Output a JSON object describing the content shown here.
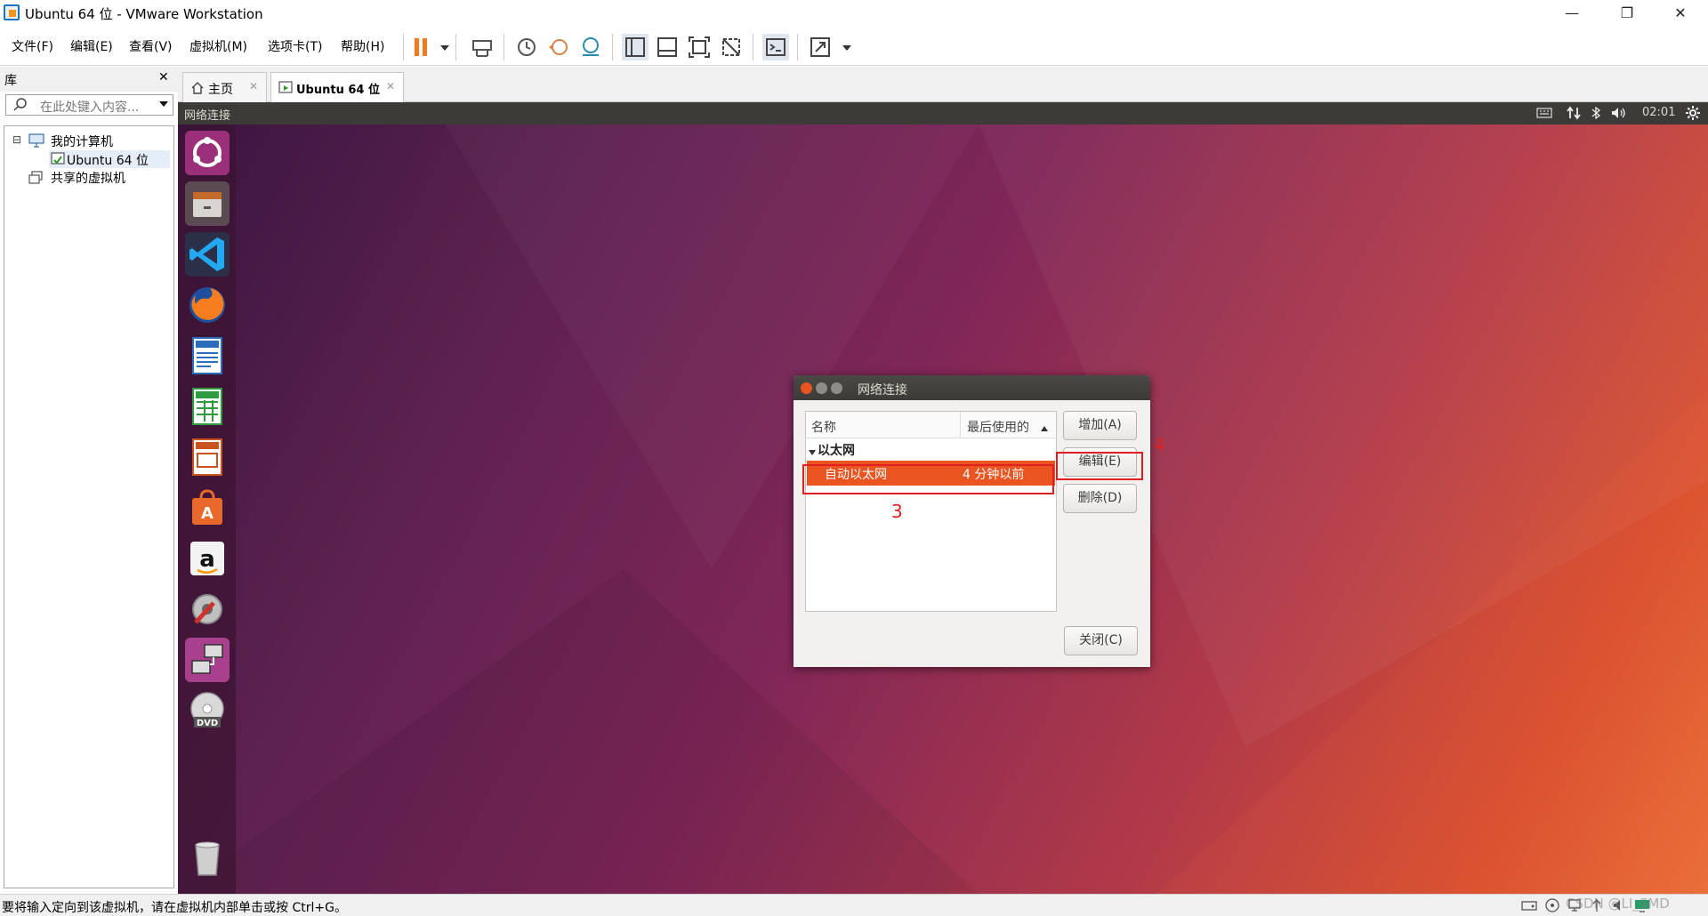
{
  "window": {
    "title": "Ubuntu 64 位 - VMware Workstation",
    "minimize": "—",
    "restore": "❐",
    "close": "✕"
  },
  "menu": {
    "file": "文件(F)",
    "edit": "编辑(E)",
    "view": "查看(V)",
    "vm": "虚拟机(M)",
    "tabs": "选项卡(T)",
    "help": "帮助(H)"
  },
  "library": {
    "title": "库",
    "close": "✕",
    "search_placeholder": "在此处键入内容...",
    "tree": {
      "my_computer": "我的计算机",
      "ubuntu": "Ubuntu 64 位",
      "shared": "共享的虚拟机",
      "collapse": "⊟"
    }
  },
  "tabs": [
    {
      "label": "主页",
      "close": "✕"
    },
    {
      "label": "Ubuntu 64 位",
      "close": "✕"
    }
  ],
  "ubuntu_panel": {
    "app_title": "网络连接",
    "clock": "02:01"
  },
  "launcher": {
    "icons": [
      "ubuntu-dash-icon",
      "files-icon",
      "vscode-icon",
      "firefox-icon",
      "writer-icon",
      "calc-icon",
      "impress-icon",
      "software-center-icon",
      "amazon-icon",
      "system-settings-icon",
      "network-connections-icon",
      "dvd-icon",
      "trash-icon"
    ]
  },
  "dialog": {
    "title": "网络连接",
    "col_name": "名称",
    "col_last_used": "最后使用的",
    "group": "以太网",
    "connection_name": "自动以太网",
    "connection_last_used": "4 分钟以前",
    "add": "增加(A)",
    "edit": "编辑(E)",
    "delete": "删除(D)",
    "close": "关闭(C)",
    "annotation_row": "3",
    "annotation_edit": "4"
  },
  "status": {
    "message": "要将输入定向到该虚拟机，请在虚拟机内部单击或按 Ctrl+G。",
    "watermark": "CSDN @LI_SMD"
  },
  "colors": {
    "accent_orange": "#e95420",
    "annotation_red": "#e02020",
    "vmware_pause": "#f47920"
  }
}
